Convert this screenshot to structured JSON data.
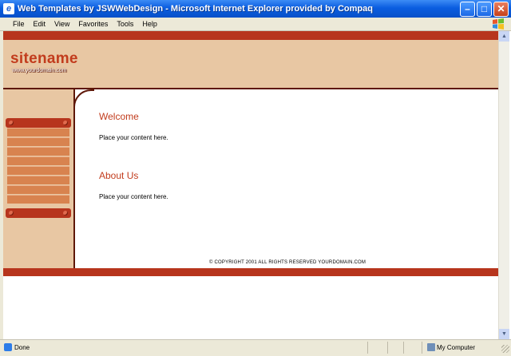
{
  "window": {
    "title": "Web Templates by JSWWebDesign - Microsoft Internet Explorer provided by Compaq",
    "minimize": "–",
    "maximize": "□",
    "close": "✕"
  },
  "menu": {
    "items": [
      "File",
      "Edit",
      "View",
      "Favorites",
      "Tools",
      "Help"
    ]
  },
  "page": {
    "sitename": "sitename",
    "domain": "www.yourdomain.com",
    "sections": [
      {
        "heading": "Welcome",
        "text": "Place your content here."
      },
      {
        "heading": "About Us",
        "text": "Place your content here."
      }
    ],
    "copyright": "© COPYRIGHT 2001 ALL RIGHTS RESERVED YOURDOMAIN.COM",
    "nav_items": 8
  },
  "status": {
    "text": "Done",
    "zone": "My Computer"
  },
  "colors": {
    "brand_red": "#b7351d",
    "header_tan": "#e8c7a3",
    "nav_orange": "#d8834f",
    "title_blue": "#0a5de0"
  },
  "icons": {
    "app": "ie-icon",
    "status": "page-icon",
    "zone": "computer-icon"
  }
}
